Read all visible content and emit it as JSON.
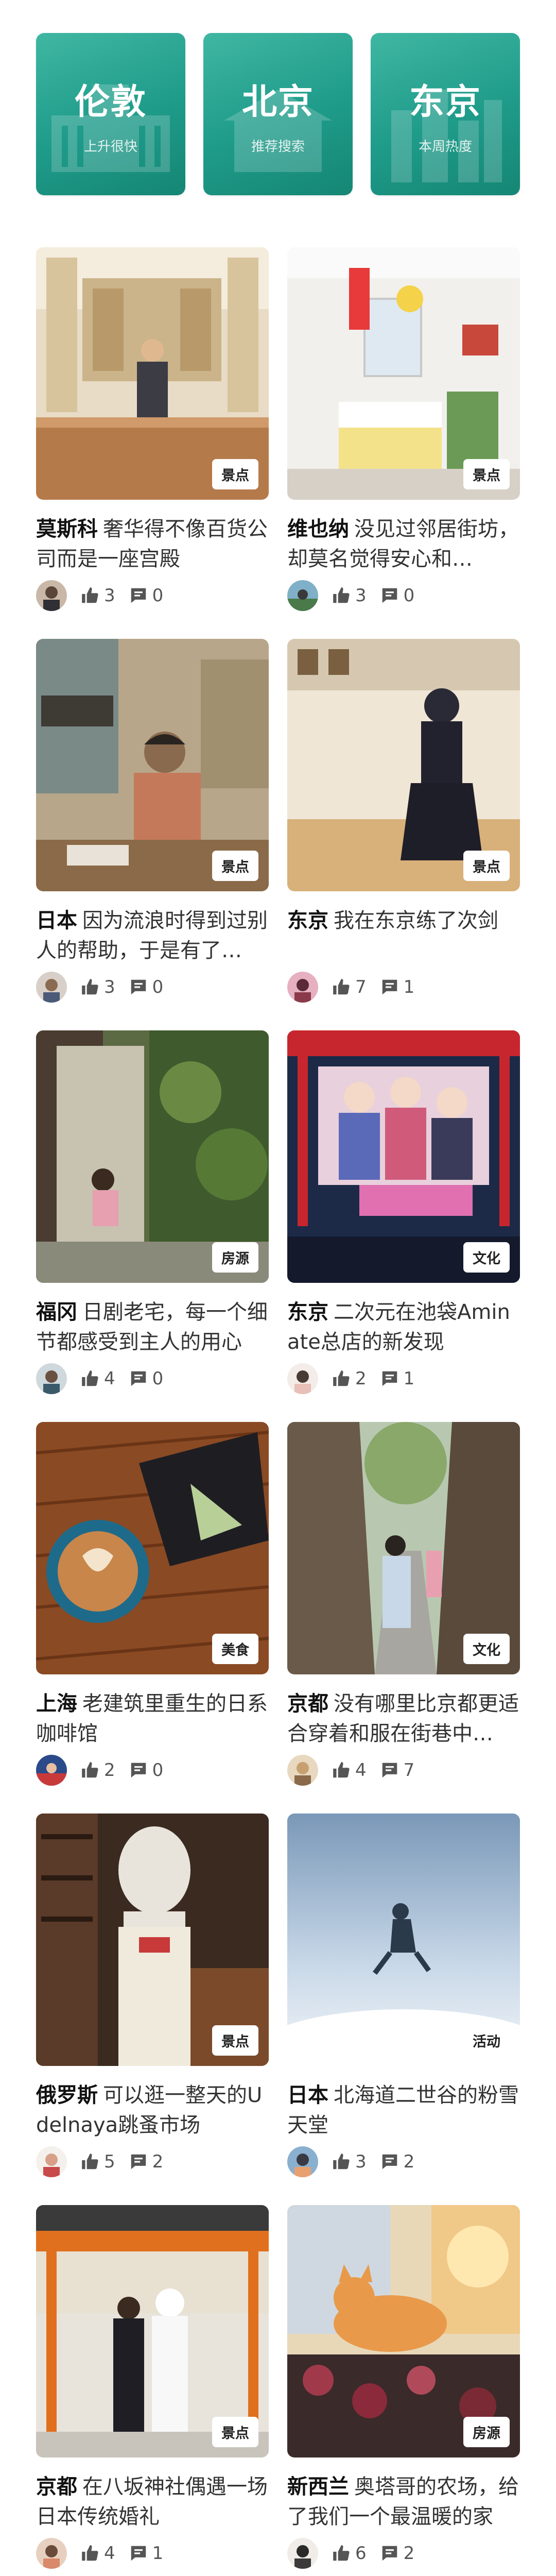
{
  "city_cards": [
    {
      "name": "伦敦",
      "sub": "上升很快"
    },
    {
      "name": "北京",
      "sub": "推荐搜索"
    },
    {
      "name": "东京",
      "sub": "本周热度"
    }
  ],
  "posts": [
    {
      "place": "莫斯科",
      "text": "奢华得不像百货公司而是一座宫殿",
      "tag": "景点",
      "likes": "3",
      "comments": "0"
    },
    {
      "place": "维也纳",
      "text": "没见过邻居街坊，却莫名觉得安心和…",
      "tag": "景点",
      "likes": "3",
      "comments": "0"
    },
    {
      "place": "日本",
      "text": "因为流浪时得到过别人的帮助，于是有了…",
      "tag": "景点",
      "likes": "3",
      "comments": "0"
    },
    {
      "place": "东京",
      "text": "我在东京练了次剑",
      "tag": "景点",
      "likes": "7",
      "comments": "1"
    },
    {
      "place": "福冈",
      "text": "日剧老宅，每一个细节都感受到主人的用心",
      "tag": "房源",
      "likes": "4",
      "comments": "0"
    },
    {
      "place": "东京",
      "text": "二次元在池袋Aminate总店的新发现",
      "tag": "文化",
      "likes": "2",
      "comments": "1"
    },
    {
      "place": "上海",
      "text": "老建筑里重生的日系咖啡馆",
      "tag": "美食",
      "likes": "2",
      "comments": "0"
    },
    {
      "place": "京都",
      "text": "没有哪里比京都更适合穿着和服在街巷中…",
      "tag": "文化",
      "likes": "4",
      "comments": "7"
    },
    {
      "place": "俄罗斯",
      "text": "可以逛一整天的Udelnaya跳蚤市场",
      "tag": "景点",
      "likes": "5",
      "comments": "2"
    },
    {
      "place": "日本",
      "text": "北海道二世谷的粉雪天堂",
      "tag": "活动",
      "likes": "3",
      "comments": "2"
    },
    {
      "place": "京都",
      "text": "在八坂神社偶遇一场日本传统婚礼",
      "tag": "景点",
      "likes": "4",
      "comments": "1"
    },
    {
      "place": "新西兰",
      "text": "奥塔哥的农场，给了我们一个最温暖的家",
      "tag": "房源",
      "likes": "6",
      "comments": "2"
    }
  ],
  "colors": {
    "card_teal": "#1f9b8a",
    "text_dark": "#111111",
    "icon_gray": "#555555"
  },
  "icons": {
    "like": "thumb-up-icon",
    "comment": "comment-icon"
  }
}
